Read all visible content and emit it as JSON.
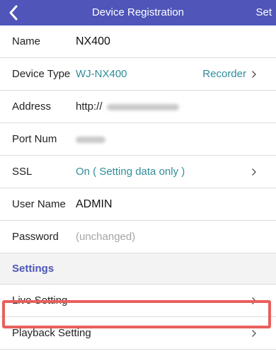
{
  "header": {
    "title": "Device Registration",
    "set_label": "Set"
  },
  "rows": {
    "name": {
      "label": "Name",
      "value": "NX400"
    },
    "device_type": {
      "label": "Device Type",
      "value": "WJ-NX400",
      "kind": "Recorder"
    },
    "address": {
      "label": "Address",
      "value_prefix": "http://"
    },
    "port": {
      "label": "Port Num"
    },
    "ssl": {
      "label": "SSL",
      "value": "On ( Setting data only )"
    },
    "user_name": {
      "label": "User Name",
      "value": "ADMIN"
    },
    "password": {
      "label": "Password",
      "value": "(unchanged)"
    }
  },
  "settings": {
    "section_label": "Settings",
    "items": [
      {
        "label": "Live Setting"
      },
      {
        "label": "Playback Setting"
      }
    ]
  },
  "colors": {
    "header_bg": "#4f55b9",
    "teal_value": "#2f8d9a",
    "section_text": "#4c56b6",
    "highlight": "#e8605c"
  },
  "icons": {
    "back": "chevron-left-icon",
    "row_arrow": "chevron-right-icon"
  }
}
